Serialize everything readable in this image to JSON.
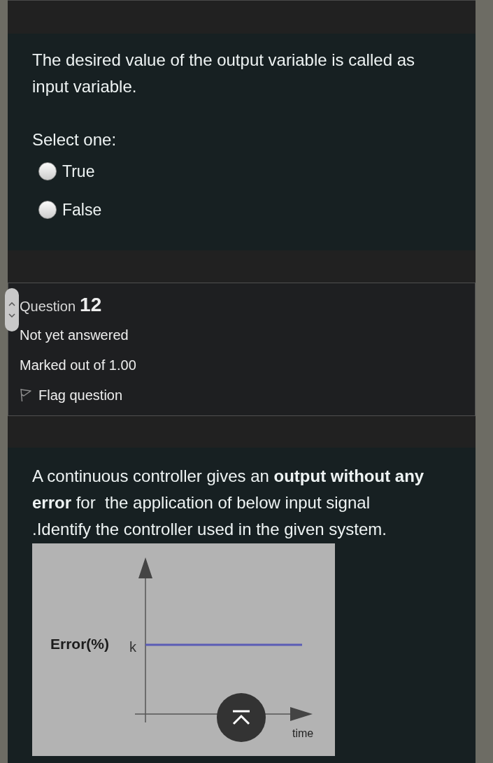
{
  "previous_question": {
    "text": "The desired value of the output variable is called as input variable.",
    "prompt": "Select one:",
    "options": [
      {
        "label": "True",
        "selected": false
      },
      {
        "label": "False",
        "selected": false
      }
    ]
  },
  "question_info": {
    "label": "Question",
    "number": "12",
    "status": "Not yet answered",
    "marks": "Marked out of 1.00",
    "flag": {
      "label": "Flag question",
      "flagged": false
    }
  },
  "question": {
    "text": "A continuous controller gives an **output without any error** for  the application of below input signal .Identify the controller used in the given system.",
    "figure": {
      "y_axis_label": "Error(%)",
      "level_label": "k",
      "x_axis_label": "time"
    }
  }
}
